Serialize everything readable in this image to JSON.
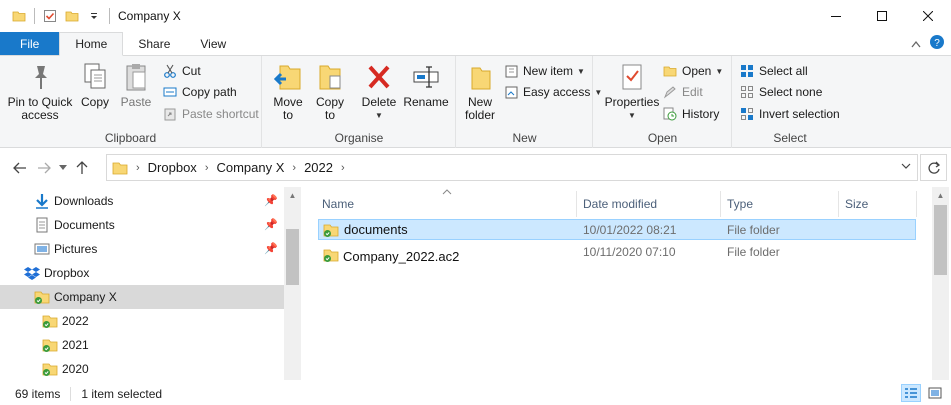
{
  "window": {
    "title": "Company X"
  },
  "ribbon_tabs": [
    "File",
    "Home",
    "Share",
    "View"
  ],
  "clipboard": {
    "pin_label": "Pin to Quick\naccess",
    "copy": "Copy",
    "paste": "Paste",
    "cut": "Cut",
    "copy_path": "Copy path",
    "paste_shortcut": "Paste shortcut",
    "group": "Clipboard"
  },
  "organise": {
    "move_to": "Move\nto",
    "copy_to": "Copy\nto",
    "delete": "Delete",
    "rename": "Rename",
    "group": "Organise"
  },
  "new": {
    "new_folder": "New\nfolder",
    "new_item": "New item",
    "easy_access": "Easy access",
    "group": "New"
  },
  "open": {
    "properties": "Properties",
    "open": "Open",
    "edit": "Edit",
    "history": "History",
    "group": "Open"
  },
  "select": {
    "select_all": "Select all",
    "select_none": "Select none",
    "invert": "Invert selection",
    "group": "Select"
  },
  "address": {
    "crumbs": [
      "Dropbox",
      "Company X",
      "2022"
    ]
  },
  "nav": {
    "downloads": "Downloads",
    "documents": "Documents",
    "pictures": "Pictures",
    "dropbox": "Dropbox",
    "company_x": "Company X",
    "y2022": "2022",
    "y2021": "2021",
    "y2020": "2020"
  },
  "columns": {
    "name": "Name",
    "date": "Date modified",
    "type": "Type",
    "size": "Size"
  },
  "files": [
    {
      "name": "documents",
      "date": "10/01/2022 08:21",
      "type": "File folder"
    },
    {
      "name": "Company_2022.ac2",
      "date": "10/11/2020 07:10",
      "type": "File folder"
    }
  ],
  "status": {
    "items": "69 items",
    "selected": "1 item selected"
  },
  "colors": {
    "file_tab": "#1979ca",
    "selection": "#cce8ff",
    "folder": "#f8d775",
    "sync_green": "#3a9b3a"
  }
}
